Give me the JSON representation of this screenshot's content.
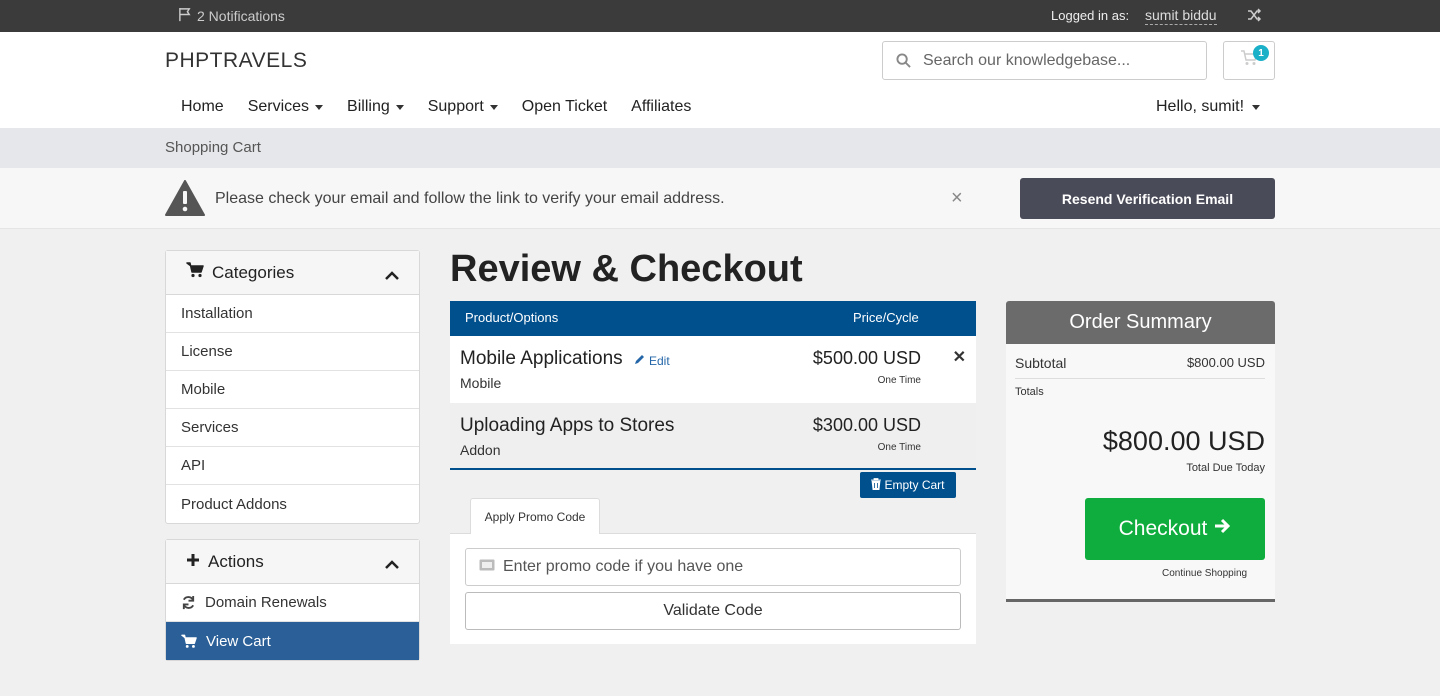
{
  "topbar": {
    "notifications": "2 Notifications",
    "logged_in_label": "Logged in as:",
    "username": "sumit biddu"
  },
  "header": {
    "logo": "PHPTRAVELS",
    "search_placeholder": "Search our knowledgebase...",
    "cart_count": "1",
    "nav": [
      "Home",
      "Services",
      "Billing",
      "Support",
      "Open Ticket",
      "Affiliates"
    ],
    "hello": "Hello, sumit!"
  },
  "breadcrumb": "Shopping Cart",
  "alert": {
    "message": "Please check your email and follow the link to verify your email address.",
    "close": "×",
    "resend_label": "Resend Verification Email"
  },
  "sidebar": {
    "categories_title": "Categories",
    "categories": [
      "Installation",
      "License",
      "Mobile",
      "Services",
      "API",
      "Product Addons"
    ],
    "actions_title": "Actions",
    "actions": [
      {
        "label": "Domain Renewals",
        "icon": "refresh-icon"
      },
      {
        "label": "View Cart",
        "icon": "cart-icon"
      }
    ]
  },
  "main": {
    "title": "Review & Checkout",
    "col_product": "Product/Options",
    "col_price": "Price/Cycle",
    "items": [
      {
        "name": "Mobile Applications",
        "group": "Mobile",
        "price": "$500.00 USD",
        "cycle": "One Time",
        "edit": "Edit"
      },
      {
        "name": "Uploading Apps to Stores",
        "group": "Addon",
        "price": "$300.00 USD",
        "cycle": "One Time"
      }
    ],
    "empty_cart": "Empty Cart",
    "promo_tab": "Apply Promo Code",
    "promo_placeholder": "Enter promo code if you have one",
    "validate": "Validate Code"
  },
  "summary": {
    "title": "Order Summary",
    "subtotal_label": "Subtotal",
    "subtotal_value": "$800.00 USD",
    "totals_label": "Totals",
    "total": "$800.00 USD",
    "due_label": "Total Due Today",
    "checkout": "Checkout",
    "continue": "Continue Shopping"
  },
  "colors": {
    "primary": "#00508e",
    "checkout_green": "#0fad3d",
    "active_sidebar": "#2a5f98",
    "resend_button": "#4a4b58"
  }
}
